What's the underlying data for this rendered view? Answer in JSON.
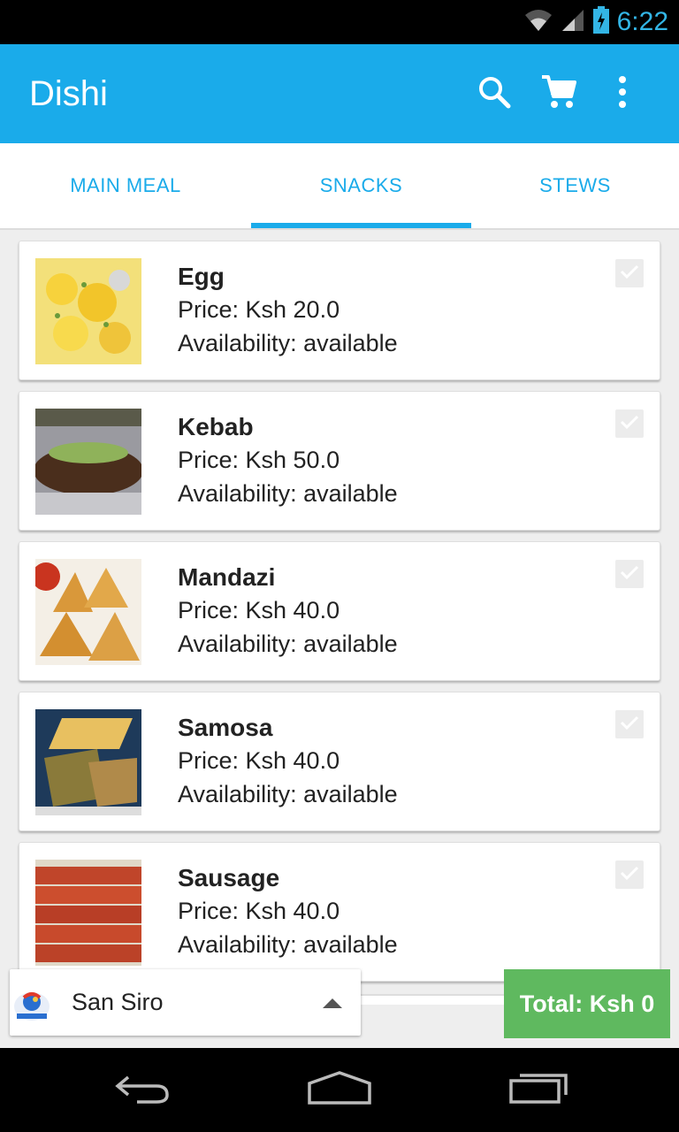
{
  "status_bar": {
    "time": "6:22"
  },
  "app_bar": {
    "title": "Dishi"
  },
  "tabs": [
    {
      "label": "MAIN MEAL"
    },
    {
      "label": "SNACKS",
      "selected": true
    },
    {
      "label": "STEWS"
    }
  ],
  "items": [
    {
      "name": "Egg",
      "price": "Price: Ksh 20.0",
      "availability": "Availability:  available",
      "image": "egg-photo",
      "checked": false
    },
    {
      "name": "Kebab",
      "price": "Price: Ksh 50.0",
      "availability": "Availability:  available",
      "image": "kebab-photo",
      "checked": false
    },
    {
      "name": "Mandazi",
      "price": "Price: Ksh 40.0",
      "availability": "Availability:  available",
      "image": "mandazi-photo",
      "checked": false
    },
    {
      "name": "Samosa",
      "price": "Price: Ksh 40.0",
      "availability": "Availability:  available",
      "image": "samosa-photo",
      "checked": false
    },
    {
      "name": "Sausage",
      "price": "Price: Ksh 40.0",
      "availability": "Availability:  available",
      "image": "sausage-photo",
      "checked": false
    }
  ],
  "location": {
    "selected": "San Siro"
  },
  "total": {
    "label": "Total: Ksh 0"
  },
  "colors": {
    "accent": "#1aabea",
    "total_bg": "#5fb95f",
    "status_time": "#33b5e5"
  }
}
